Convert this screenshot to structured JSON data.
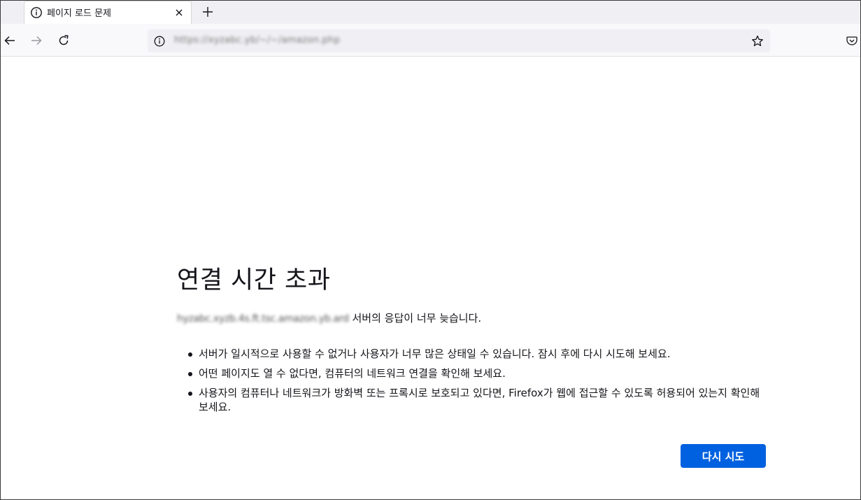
{
  "tab": {
    "title": "페이지 로드 문제",
    "icon": "info-icon"
  },
  "toolbar": {
    "url": "https://xyzabc.yb/~/~/amazon.php",
    "icons": [
      "back-arrow-icon",
      "forward-arrow-icon",
      "reload-icon",
      "info-icon",
      "star-icon",
      "pocket-icon",
      "close-icon",
      "plus-icon"
    ]
  },
  "error": {
    "title": "연결 시간 초과",
    "host": "hyzabc.xyzb.4s.ft.tsc.amazon.yb.ard",
    "description_suffix": " 서버의 응답이 너무 늦습니다.",
    "items": [
      "서버가 일시적으로 사용할 수 없거나 사용자가 너무 많은 상태일 수 있습니다. 잠시 후에 다시 시도해 보세요.",
      "어떤 페이지도 열 수 없다면, 컴퓨터의 네트워크 연결을 확인해 보세요.",
      "사용자의 컴퓨터나 네트워크가 방화벽 또는 프록시로 보호되고 있다면, Firefox가 웹에 접근할 수 있도록 허용되어 있는지 확인해 보세요."
    ],
    "retry_label": "다시 시도"
  },
  "colors": {
    "accent": "#0061e0",
    "text": "#15141a",
    "tabstrip": "#f0f0f4"
  }
}
